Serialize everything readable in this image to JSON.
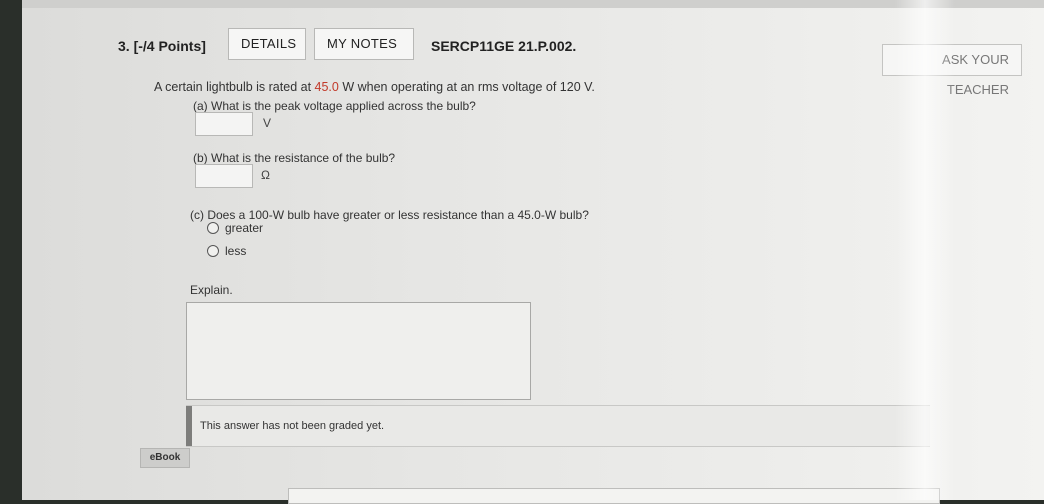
{
  "question": {
    "number_points": "3. [-/4 Points]",
    "details_label": "DETAILS",
    "notes_label": "MY NOTES",
    "problem_code": "SERCP11GE 21.P.002.",
    "teacher_label": "ASK YOUR TEACHER"
  },
  "prompt": {
    "before": "A certain lightbulb is rated at ",
    "value": "45.0",
    "after": " W when operating at an rms voltage of 120 V."
  },
  "part_a": {
    "text": "(a) What is the peak voltage applied across the bulb?",
    "unit": "V",
    "value": ""
  },
  "part_b": {
    "text": "(b) What is the resistance of the bulb?",
    "unit": "Ω",
    "value": ""
  },
  "part_c": {
    "text": "(c) Does a 100-W bulb have greater or less resistance than a 45.0-W bulb?",
    "options": [
      "greater",
      "less"
    ]
  },
  "explain": {
    "label": "Explain.",
    "value": ""
  },
  "grading_note": "This answer has not been graded yet.",
  "ebook_label": "eBook",
  "colors": {
    "highlight": "#c23a2a"
  }
}
